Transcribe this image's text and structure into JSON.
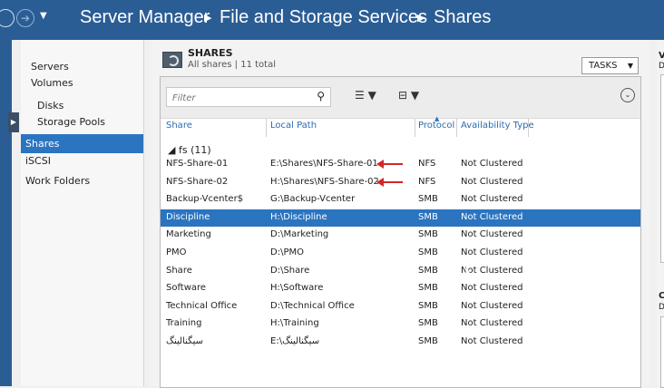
{
  "titlebar": {
    "breadcrumb": [
      "Server Manager",
      "File and Storage Services",
      "Shares"
    ]
  },
  "sidebar": {
    "items": [
      {
        "label": "Servers",
        "indent": false,
        "selected": false
      },
      {
        "label": "Volumes",
        "indent": false,
        "selected": false
      },
      {
        "label": "Disks",
        "indent": true,
        "selected": false
      },
      {
        "label": "Storage Pools",
        "indent": true,
        "selected": false
      },
      {
        "label": "Shares",
        "indent": false,
        "selected": true
      },
      {
        "label": "iSCSI",
        "indent": false,
        "selected": false
      },
      {
        "label": "Work Folders",
        "indent": false,
        "selected": false
      }
    ]
  },
  "tile": {
    "title": "SHARES",
    "subtitle": "All shares | 11 total",
    "tasks_label": "TASKS"
  },
  "filter": {
    "placeholder": "Filter"
  },
  "columns": [
    "Share",
    "Local Path",
    "Protocol",
    "Availability Type"
  ],
  "group": {
    "label": "fs (11)"
  },
  "rows": [
    {
      "share": "NFS-Share-01",
      "path": "E:\\Shares\\NFS-Share-01",
      "protocol": "NFS",
      "availability": "Not Clustered",
      "selected": false,
      "arrow": true
    },
    {
      "share": "NFS-Share-02",
      "path": "H:\\Shares\\NFS-Share-02",
      "protocol": "NFS",
      "availability": "Not Clustered",
      "selected": false,
      "arrow": true
    },
    {
      "share": "Backup-Vcenter$",
      "path": "G:\\Backup-Vcenter",
      "protocol": "SMB",
      "availability": "Not Clustered",
      "selected": false,
      "arrow": false
    },
    {
      "share": "Discipline",
      "path": "H:\\Discipline",
      "protocol": "SMB",
      "availability": "Not Clustered",
      "selected": true,
      "arrow": false
    },
    {
      "share": "Marketing",
      "path": "D:\\Marketing",
      "protocol": "SMB",
      "availability": "Not Clustered",
      "selected": false,
      "arrow": false
    },
    {
      "share": "PMO",
      "path": "D:\\PMO",
      "protocol": "SMB",
      "availability": "Not Clustered",
      "selected": false,
      "arrow": false
    },
    {
      "share": "Share",
      "path": "D:\\Share",
      "protocol": "SMB",
      "availability": "Not Clustered",
      "selected": false,
      "arrow": false
    },
    {
      "share": "Software",
      "path": "H:\\Software",
      "protocol": "SMB",
      "availability": "Not Clustered",
      "selected": false,
      "arrow": false
    },
    {
      "share": "Technical Office",
      "path": "D:\\Technical Office",
      "protocol": "SMB",
      "availability": "Not Clustered",
      "selected": false,
      "arrow": false
    },
    {
      "share": "Training",
      "path": "H:\\Training",
      "protocol": "SMB",
      "availability": "Not Clustered",
      "selected": false,
      "arrow": false
    },
    {
      "share": "سیگنالینگ",
      "path": "E:\\سیگنالینگ",
      "protocol": "SMB",
      "availability": "Not Clustered",
      "selected": false,
      "arrow": false
    }
  ],
  "right_pane": {
    "letters": [
      "V",
      "D",
      "C",
      "D"
    ]
  },
  "colors": {
    "titlebar": "#2b5d95",
    "selection": "#2b74c0",
    "header_text": "#2b6cb0",
    "annotation_arrow": "#d3272b"
  }
}
